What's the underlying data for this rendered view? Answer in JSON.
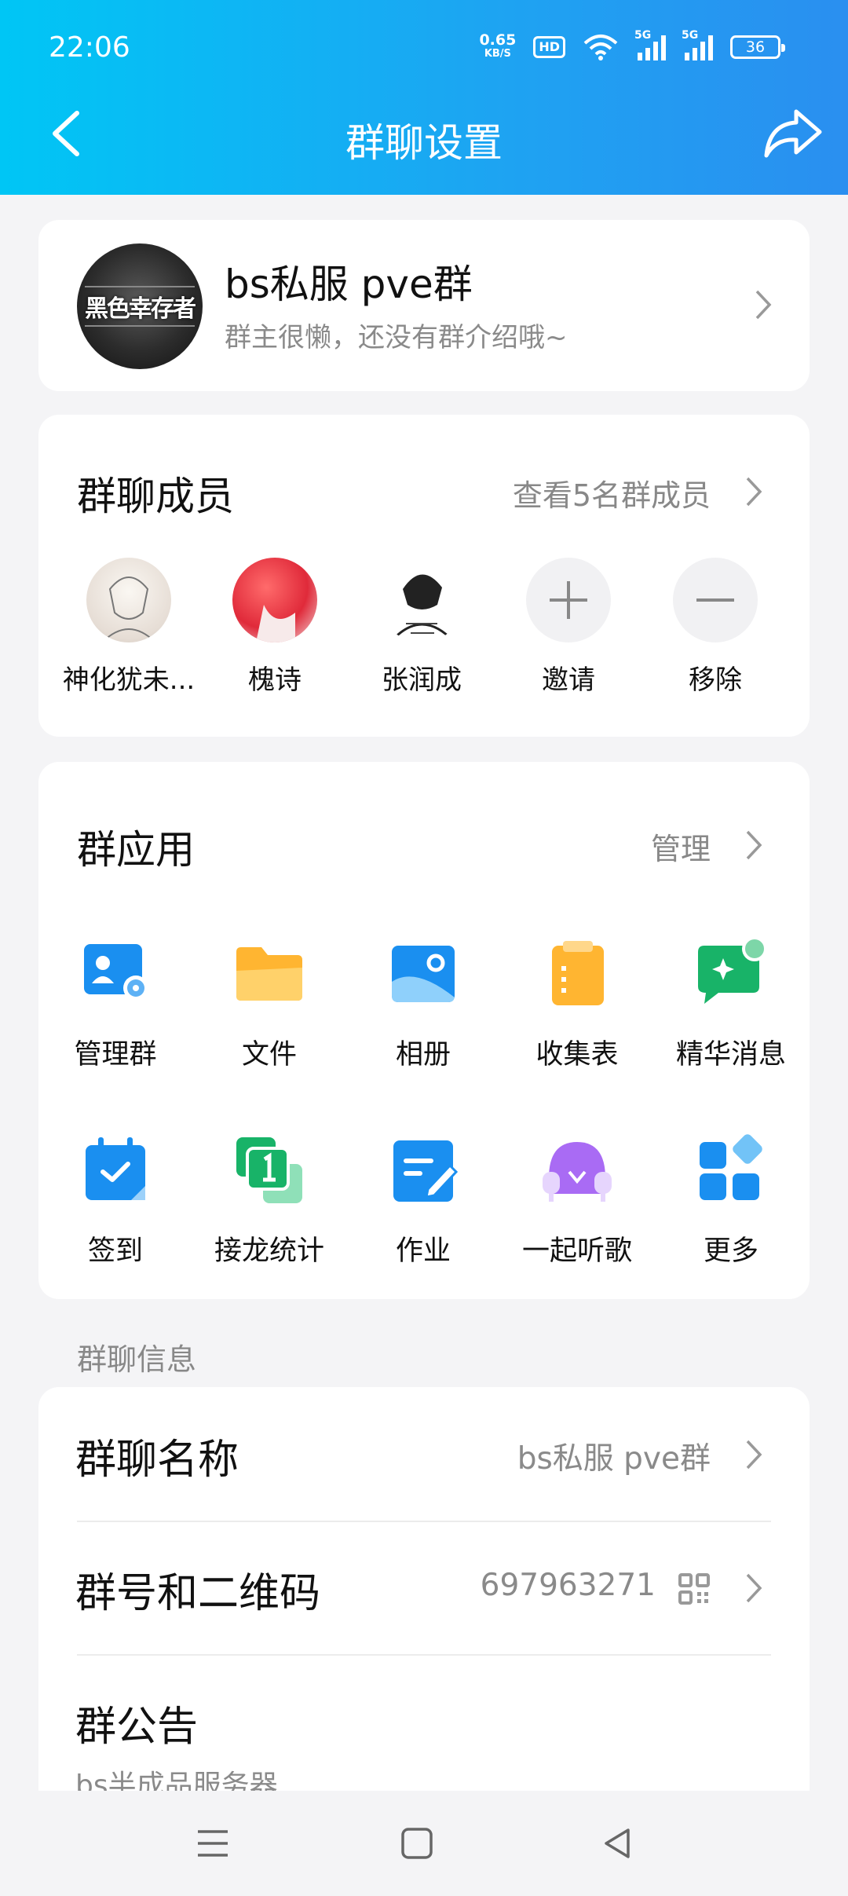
{
  "status_bar": {
    "time": "22:06",
    "speed_value": "0.65",
    "speed_unit": "KB/S",
    "hd": "HD",
    "sim1": "5G",
    "sim2": "5G",
    "battery": "36"
  },
  "header": {
    "title": "群聊设置",
    "back_icon": "chevron-left-icon",
    "share_icon": "share-arrow-icon"
  },
  "group": {
    "avatar_text": "黑色幸存者",
    "name": "bs私服 pve群",
    "description": "群主很懒，还没有群介绍哦~"
  },
  "members": {
    "title": "群聊成员",
    "view_all": "查看5名群成员",
    "items": [
      {
        "name": "神化犹未..."
      },
      {
        "name": "槐诗"
      },
      {
        "name": "张润成"
      },
      {
        "name": "邀请"
      },
      {
        "name": "移除"
      }
    ]
  },
  "apps": {
    "title": "群应用",
    "manage": "管理",
    "items": [
      {
        "label": "管理群",
        "icon": "manage-group-icon"
      },
      {
        "label": "文件",
        "icon": "folder-icon"
      },
      {
        "label": "相册",
        "icon": "album-icon"
      },
      {
        "label": "收集表",
        "icon": "clipboard-icon"
      },
      {
        "label": "精华消息",
        "icon": "essence-message-icon"
      },
      {
        "label": "签到",
        "icon": "calendar-checkin-icon"
      },
      {
        "label": "接龙统计",
        "icon": "relay-icon"
      },
      {
        "label": "作业",
        "icon": "homework-icon"
      },
      {
        "label": "一起听歌",
        "icon": "music-together-icon"
      },
      {
        "label": "更多",
        "icon": "more-apps-icon"
      }
    ]
  },
  "info": {
    "section_label": "群聊信息",
    "name_row": {
      "title": "群聊名称",
      "value": "bs私服 pve群"
    },
    "number_row": {
      "title": "群号和二维码",
      "value": "697963271"
    },
    "notice_row": {
      "title": "群公告",
      "preview": "bs半成品服务器"
    }
  },
  "colors": {
    "header_start": "#00c6f5",
    "header_end": "#2a8ff0",
    "app_blue": "#1a8ff0",
    "app_yellow": "#ffb531",
    "app_green": "#18b368",
    "app_purple": "#a96bf4"
  }
}
